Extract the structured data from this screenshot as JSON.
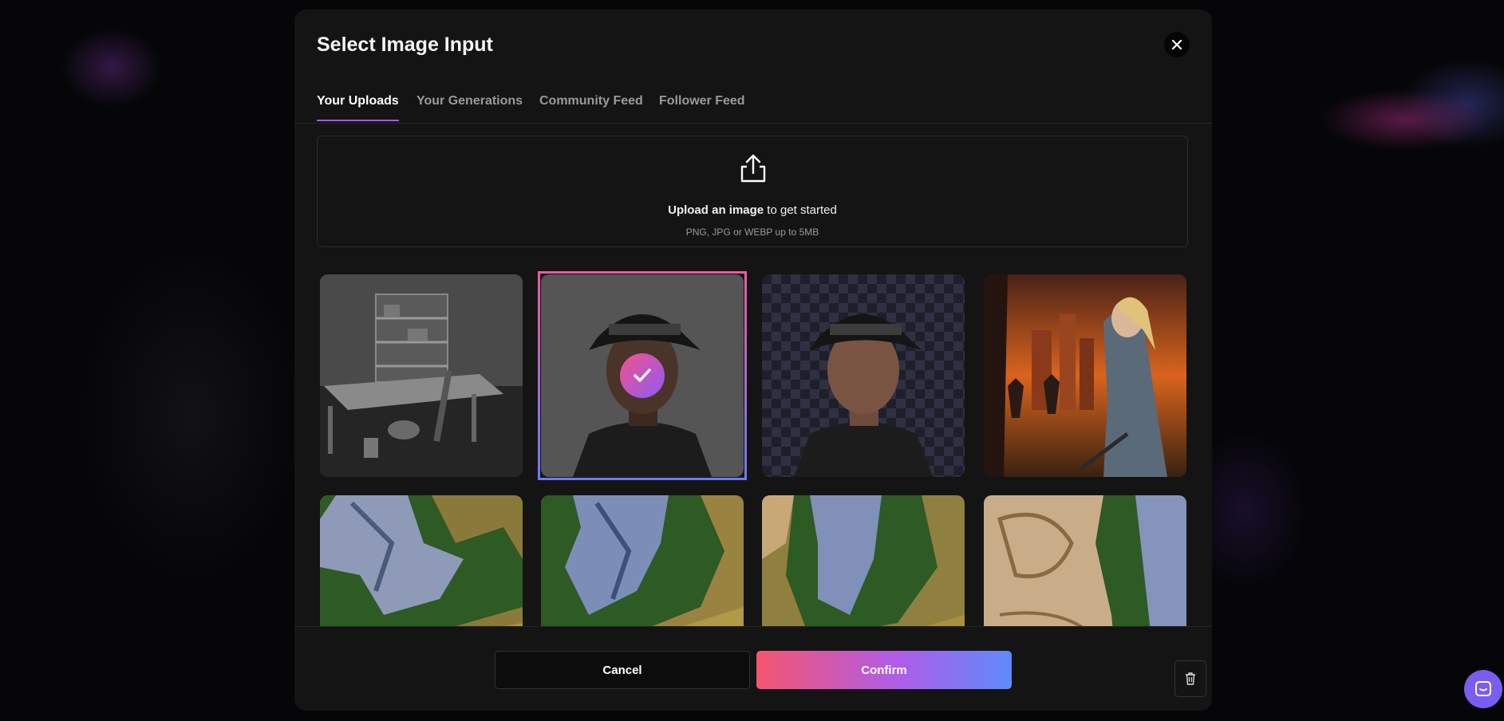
{
  "dialog": {
    "title": "Select Image Input",
    "close_icon": "close-icon"
  },
  "tabs": [
    {
      "label": "Your Uploads",
      "active": true
    },
    {
      "label": "Your Generations",
      "active": false
    },
    {
      "label": "Community Feed",
      "active": false
    },
    {
      "label": "Follower Feed",
      "active": false
    }
  ],
  "upload": {
    "icon": "upload-icon",
    "text_bold": "Upload an image",
    "text_rest": " to get started",
    "subtext": "PNG, JPG or WEBP up to 5MB"
  },
  "images": [
    {
      "subject": "grayscale workshop with shelves and table",
      "selected": false
    },
    {
      "subject": "man in black hat, gray background",
      "selected": true
    },
    {
      "subject": "man in black hat, transparent background",
      "selected": false
    },
    {
      "subject": "girl with sword facing zombies at sunset city",
      "selected": false
    },
    {
      "subject": "aerial map mountains forest fields",
      "selected": false
    },
    {
      "subject": "aerial map mountains forest fields",
      "selected": false
    },
    {
      "subject": "aerial map mountains forest fields",
      "selected": false
    },
    {
      "subject": "aerial map desert and mountains",
      "selected": false
    }
  ],
  "footer": {
    "cancel_label": "Cancel",
    "confirm_label": "Confirm",
    "trash_icon": "trash-icon"
  },
  "colors": {
    "accent_pink": "#f5556f",
    "accent_purple": "#b05ce8",
    "accent_blue": "#5e8bfa",
    "chat_bubble": "#7b5cf0"
  }
}
